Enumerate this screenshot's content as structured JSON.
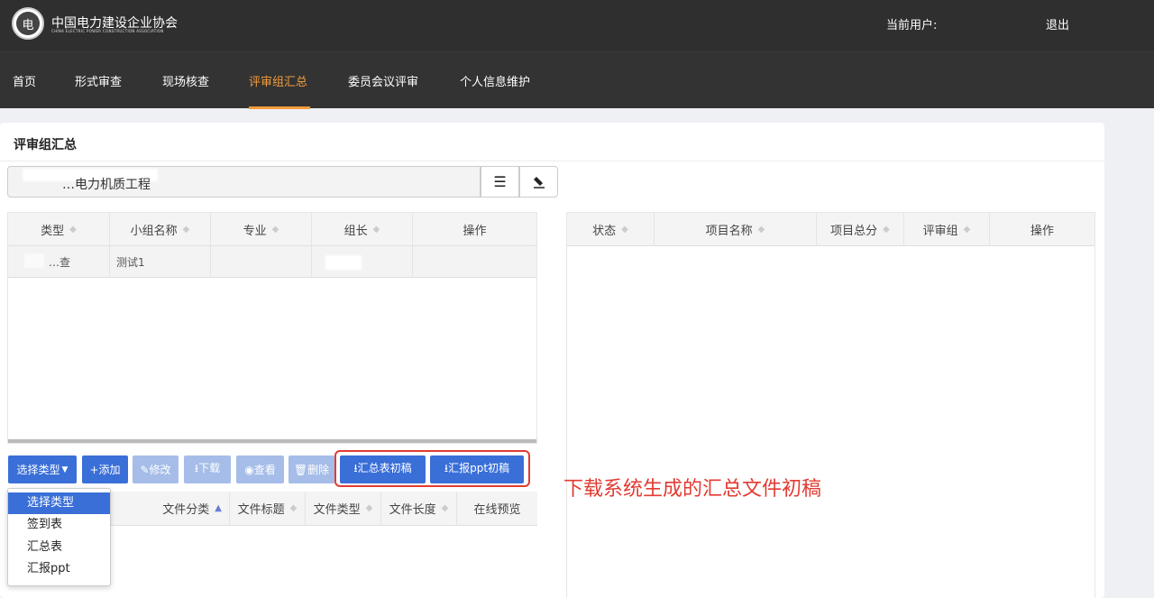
{
  "header": {
    "logo_glyph": "电",
    "brand_cn": "中国电力建设企业协会",
    "brand_en": "CHINA ELECTRIC POWER CONSTRUCTION ASSOCIATION",
    "current_user_label": "当前用户:",
    "logout_label": "退出"
  },
  "nav": {
    "items": [
      {
        "label": "首页"
      },
      {
        "label": "形式审查"
      },
      {
        "label": "现场核查"
      },
      {
        "label": "评审组汇总"
      },
      {
        "label": "委员会议评审"
      },
      {
        "label": "个人信息维护"
      }
    ],
    "active": "评审组汇总"
  },
  "panel": {
    "title": "评审组汇总",
    "project_select_value": "…电力机质工程",
    "list_icon": "list-icon",
    "eraser_icon": "eraser-icon"
  },
  "group_table": {
    "columns": [
      "类型",
      "小组名称",
      "专业",
      "组长",
      "操作"
    ],
    "rows": [
      {
        "type": "…查",
        "name": "测试1",
        "major": "",
        "leader": "",
        "ops": ""
      }
    ]
  },
  "project_table": {
    "columns": [
      "状态",
      "项目名称",
      "项目总分",
      "评审组",
      "操作"
    ],
    "rows": []
  },
  "toolbar": {
    "select_type_label": "选择类型",
    "add_label": "+添加",
    "edit_label": "✎修改",
    "download_label": "⭳下载",
    "view_label": "◉查看",
    "delete_label": "🗑删除",
    "summary_draft_label": "⭳汇总表初稿",
    "ppt_draft_label": "⭳汇报ppt初稿"
  },
  "file_table": {
    "columns": [
      "文件分类",
      "文件标题",
      "文件类型",
      "文件长度",
      "在线预览"
    ]
  },
  "type_dropdown": {
    "options": [
      "选择类型",
      "签到表",
      "汇总表",
      "汇报ppt"
    ],
    "selected": "选择类型"
  },
  "annotation": {
    "text": "下载系统生成的汇总文件初稿",
    "color": "#e23b32"
  },
  "colors": {
    "primary": "#3a6fd8",
    "accent": "#f39c3c",
    "topbar": "#2f2f2f"
  }
}
